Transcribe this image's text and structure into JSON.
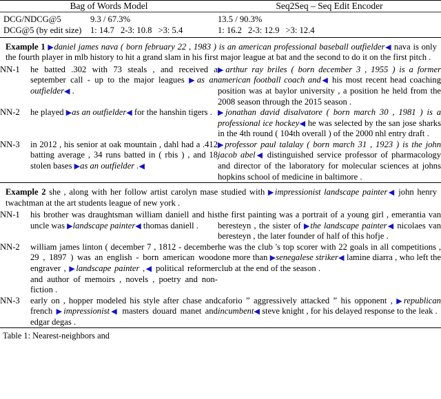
{
  "table": {
    "columns": [
      {
        "id": "bow",
        "header": "Bag of Words Model"
      },
      {
        "id": "seq2seq",
        "header": "Seq2Seq – Seq Edit Encoder"
      }
    ],
    "metrics": [
      {
        "name": "DCG/NDCG@5",
        "bow": "9.3 / 67.3%",
        "seq2seq": "13.5 / 90.3%"
      },
      {
        "name": "DCG@5 (by edit size)",
        "bow_parts": [
          "1: 14.7",
          "2-3: 10.8",
          ">3: 5.4"
        ],
        "seq2seq_parts": [
          "1: 16.2",
          "2-3: 12.9",
          ">3: 12.4"
        ]
      }
    ],
    "examples": [
      {
        "label": "Example 1",
        "lead_pre": " ",
        "lead_highlight": "daniel james nava ( born february 22 , 1983 ) is an american professional baseball outfielder",
        "lead_post": " nava is only the fourth player in mlb history to hit a grand slam in his first major league at bat and the second to do it on the first pitch .",
        "rows": [
          {
            "label": "NN-1",
            "left_pre": "he batted .302 with 73 steals , and received a september call - up to the major leagues ",
            "left_highlight": "as an outfielder",
            "left_post": " .",
            "right_pre": "",
            "right_highlight": "arthur ray briles ( born december 3 , 1955 ) is a former american football coach and",
            "right_post": " his most recent head coaching position was at baylor university , a position he held from the 2008 season through the 2015 season ."
          },
          {
            "label": "NN-2",
            "left_pre": "he played ",
            "left_highlight": "as an outfielder",
            "left_post": " for the hanshin tigers .",
            "right_pre": "",
            "right_highlight": "jonathan david disalvatore ( born march 30 , 1981 ) is a professional ice hockey",
            "right_post": " he was selected by the san jose sharks in the 4th round ( 104th overall ) of the 2000 nhl entry draft ."
          },
          {
            "label": "NN-3",
            "left_pre": "in 2012 , his senior at oak mountain , dahl had a .412 batting average , 34 runs batted in ( rbis ) , and 18 stolen bases ",
            "left_highlight": "as an outfielder .",
            "left_post": "",
            "right_pre": "",
            "right_highlight": "professor paul talalay ( born march 31 , 1923 ) is the john jacob abel",
            "right_post": " distinguished service professor of pharmacology and director of the laboratory for molecular sciences at johns hopkins school of medicine in baltimore ."
          }
        ]
      },
      {
        "label": "Example 2",
        "lead_pre": " she , along with her follow artist carolyn mase studied with ",
        "lead_highlight": "impressionist landscape painter",
        "lead_post": " john henry twachtman at the art students league of new york .",
        "rows": [
          {
            "label": "NN-1",
            "left_pre": "his brother was draughtsman william daniell and his uncle was ",
            "left_highlight": "landscape painter",
            "left_post": " thomas daniell .",
            "right_pre": "the first painting was a portrait of a young girl , emerantia van beresteyn , the sister of ",
            "right_highlight": "the landscape painter",
            "right_post": " nicolaes van beresteyn , the later founder of half of this hofje ."
          },
          {
            "label": "NN-2",
            "left_pre": "william james linton ( december 7 , 1812 - december 29 , 1897 ) was an english - born american wood engraver , ",
            "left_highlight": "landscape painter ,",
            "left_post": " political reformer and author of memoirs , novels , poetry and non-fiction .",
            "right_pre": "he was the club 's top scorer with 22 goals in all competitions , one more than ",
            "right_highlight": "senegalese striker",
            "right_post": " lamine diarra , who left the club at the end of the season ."
          },
          {
            "label": "NN-3",
            "left_pre": "early on , hopper modeled his style after chase and french ",
            "left_highlight": "impressionist",
            "left_post": " masters douard manet and edgar degas .",
            "right_pre": "caforio ” aggressively attacked ” his opponent , ",
            "right_highlight": "republican incumbent",
            "right_post": " steve knight , for his delayed response to the leak ."
          }
        ]
      }
    ],
    "markers": {
      "open": "▶",
      "close": "◀"
    },
    "highlight_color": "#1414c8",
    "caption": "Table 1: Nearest-neighbors and"
  }
}
